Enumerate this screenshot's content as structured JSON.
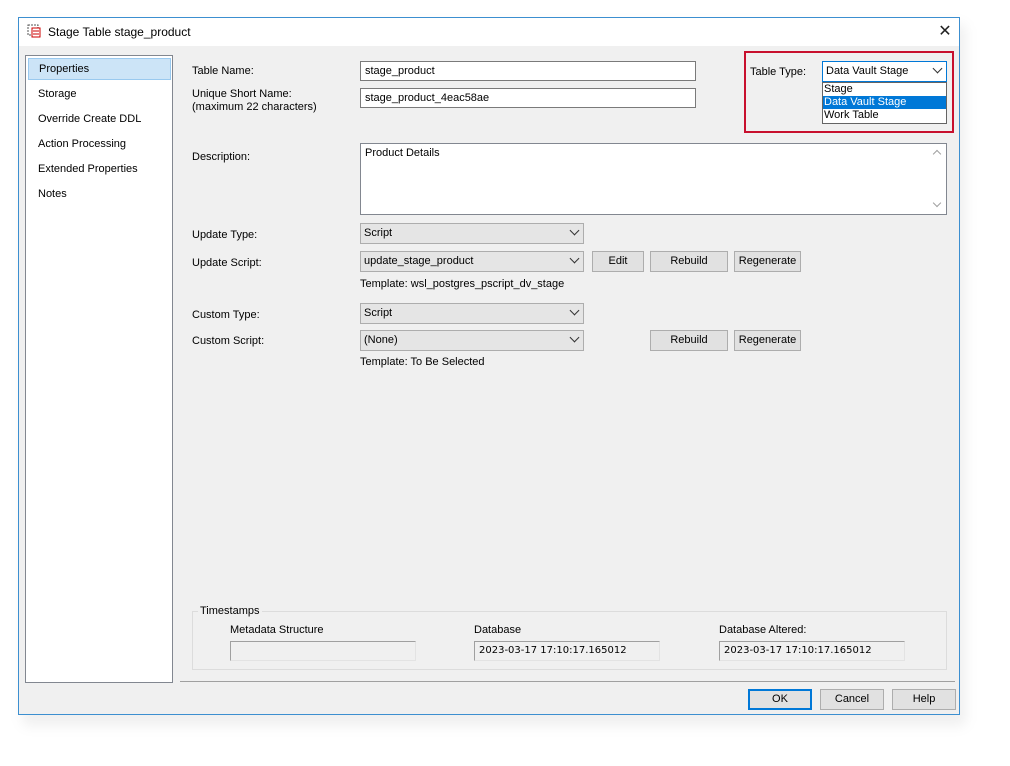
{
  "window": {
    "title": "Stage Table stage_product",
    "close_glyph": "✕"
  },
  "nav": {
    "items": [
      {
        "label": "Properties",
        "selected": true
      },
      {
        "label": "Storage",
        "selected": false
      },
      {
        "label": "Override Create DDL",
        "selected": false
      },
      {
        "label": "Action Processing",
        "selected": false
      },
      {
        "label": "Extended Properties",
        "selected": false
      },
      {
        "label": "Notes",
        "selected": false
      }
    ]
  },
  "form": {
    "table_name_label": "Table Name:",
    "table_name_value": "stage_product",
    "short_name_label_1": "Unique Short Name:",
    "short_name_label_2": "(maximum 22 characters)",
    "short_name_value": "stage_product_4eac58ae",
    "table_type_label": "Table Type:",
    "table_type_value": "Data Vault Stage",
    "table_type_options": [
      "Stage",
      "Data Vault Stage",
      "Work Table"
    ],
    "description_label": "Description:",
    "description_value": "Product Details",
    "update_type_label": "Update Type:",
    "update_type_value": "Script",
    "update_script_label": "Update Script:",
    "update_script_value": "update_stage_product",
    "update_template": "Template: wsl_postgres_pscript_dv_stage",
    "custom_type_label": "Custom Type:",
    "custom_type_value": "Script",
    "custom_script_label": "Custom Script:",
    "custom_script_value": "(None)",
    "custom_template": "Template: To Be Selected"
  },
  "buttons": {
    "edit": "Edit",
    "rebuild": "Rebuild",
    "regenerate": "Regenerate",
    "ok": "OK",
    "cancel": "Cancel",
    "help": "Help"
  },
  "timestamps": {
    "group_label": "Timestamps",
    "metadata_label": "Metadata Structure",
    "metadata_value": "",
    "database_label": "Database",
    "database_value": "2023-03-17 17:10:17.165012",
    "altered_label": "Database Altered:",
    "altered_value": "2023-03-17 17:10:17.165012"
  },
  "colors": {
    "accent": "#0078d7",
    "highlight_border": "#c8102e",
    "nav_selected": "#cce4f7"
  }
}
